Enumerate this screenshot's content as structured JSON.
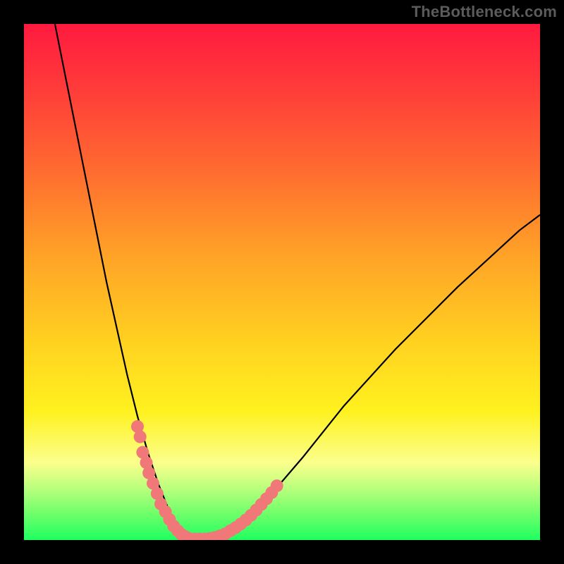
{
  "watermark": "TheBottleneck.com",
  "chart_data": {
    "type": "line",
    "title": "",
    "xlabel": "",
    "ylabel": "",
    "xlim": [
      0,
      100
    ],
    "ylim": [
      0,
      100
    ],
    "grid": false,
    "series": [
      {
        "name": "bottleneck-curve",
        "x": [
          6,
          12,
          16,
          20,
          22,
          24,
          26,
          28,
          29,
          30,
          32,
          34,
          36,
          38,
          40,
          42,
          44,
          48,
          54,
          62,
          72,
          84,
          96,
          100
        ],
        "y": [
          100,
          70,
          50,
          32,
          24,
          17,
          11,
          6,
          3,
          1,
          0,
          0,
          0,
          1,
          2,
          3,
          5,
          9,
          16,
          26,
          37,
          49,
          60,
          63
        ]
      }
    ],
    "markers": [
      {
        "name": "left-arm-dots",
        "x": [
          22,
          22.5,
          23,
          23.7,
          24.2,
          25,
          25.8,
          26.5,
          27.4,
          28.2,
          29,
          29.8,
          30.5,
          31.2
        ],
        "y": [
          22,
          20,
          17,
          15,
          13,
          11,
          9,
          7,
          5.5,
          4,
          2.7,
          1.8,
          1.1,
          0.7
        ]
      },
      {
        "name": "valley-dots",
        "x": [
          32,
          33,
          34,
          35,
          36,
          37,
          38,
          39
        ],
        "y": [
          0.3,
          0.2,
          0.2,
          0.2,
          0.3,
          0.5,
          0.8,
          1.2
        ]
      },
      {
        "name": "right-arm-dots",
        "x": [
          40,
          41,
          42,
          43,
          44,
          45,
          46,
          47,
          48,
          49
        ],
        "y": [
          1.8,
          2.4,
          3.1,
          3.9,
          4.8,
          5.8,
          6.9,
          8.0,
          9.2,
          10.5
        ]
      }
    ],
    "marker_style": {
      "color": "#f07878",
      "radius_px": 9
    }
  }
}
